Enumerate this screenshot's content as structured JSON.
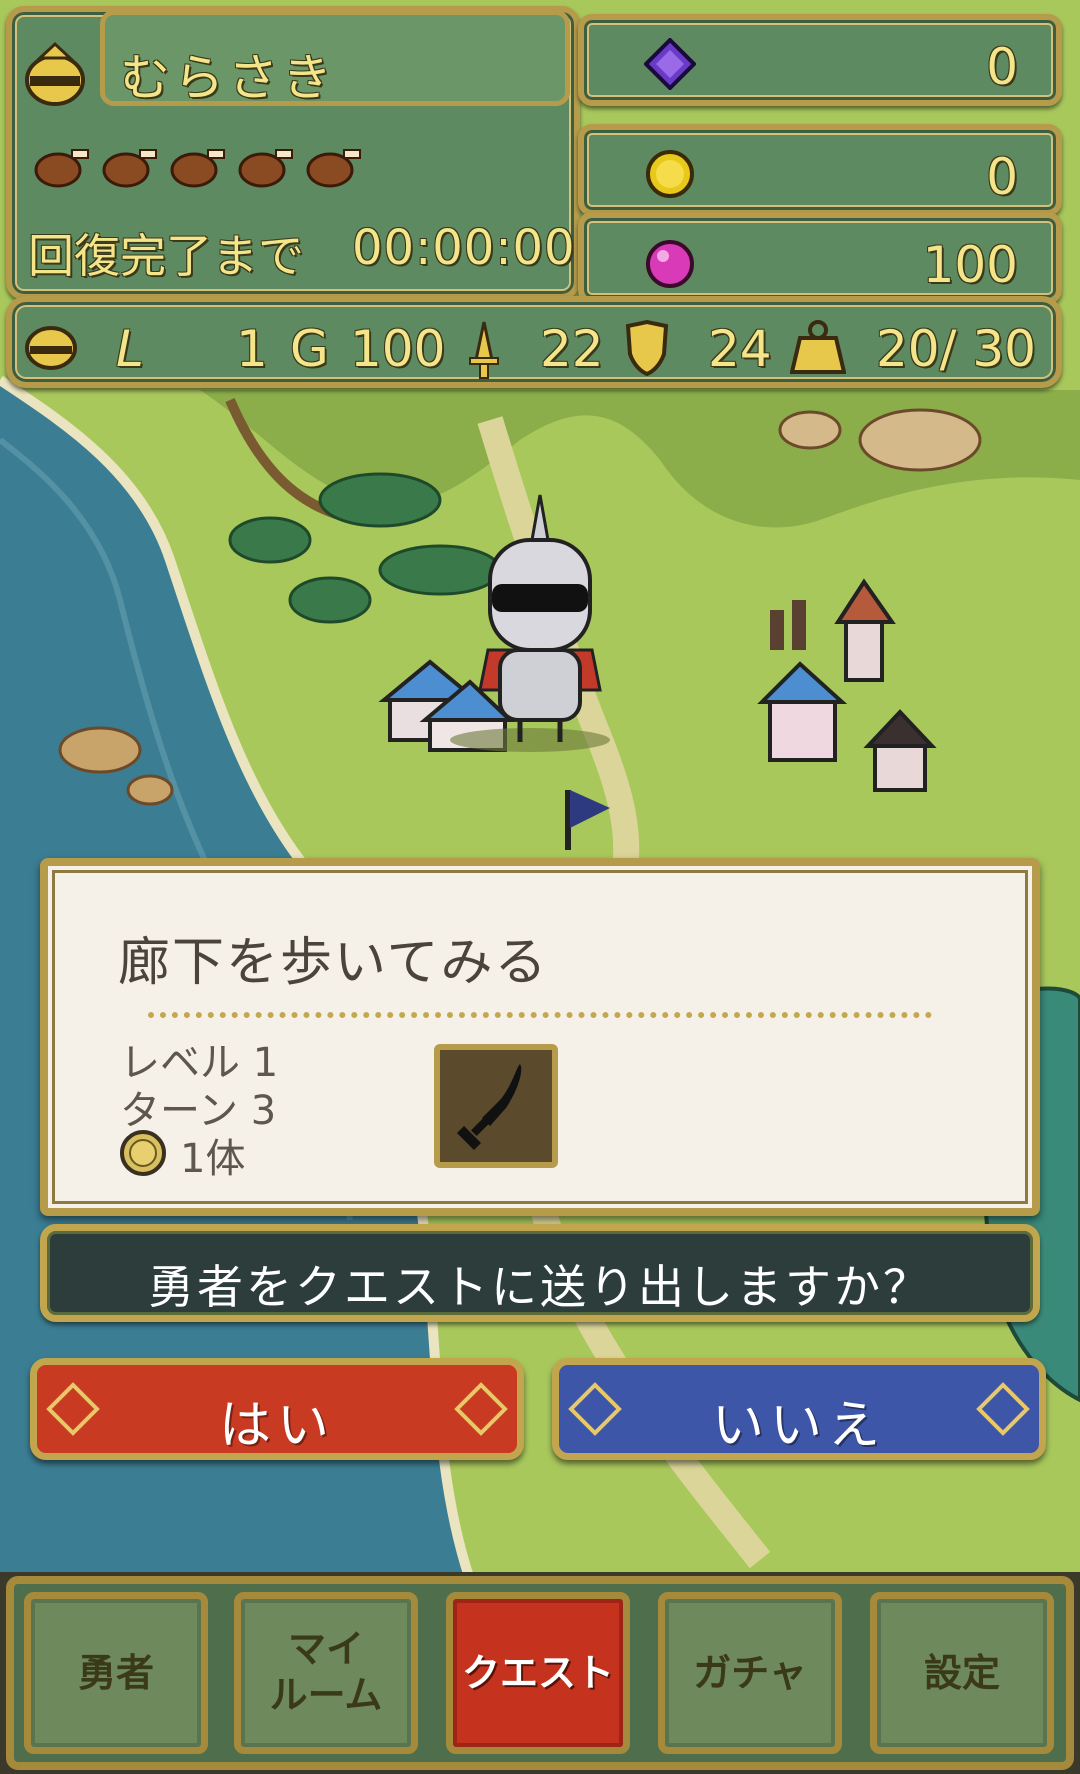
{
  "player": {
    "name": "むらさき"
  },
  "stamina": {
    "meat_count": 5,
    "recovery_label": "回復完了まで",
    "recovery_time": "00:00:00"
  },
  "currencies": {
    "gem": "0",
    "coin": "0",
    "orb": "100"
  },
  "stats": {
    "level_icon": "L",
    "level": "1",
    "gold_icon": "G",
    "gold": "100",
    "attack": "22",
    "defense": "24",
    "weight": "20/ 30"
  },
  "quest": {
    "title": "廊下を歩いてみる",
    "level": "レベル 1",
    "turn": "ターン 3",
    "enemy": "1体",
    "reward_icon": "sword-icon"
  },
  "prompt": {
    "text": "勇者をクエストに送り出しますか？"
  },
  "buttons": {
    "yes": "はい",
    "no": "いいえ"
  },
  "nav": {
    "tabs": [
      {
        "line1": "勇者",
        "line2": ""
      },
      {
        "line1": "マイ",
        "line2": "ルーム"
      },
      {
        "line1": "クエスト",
        "line2": ""
      },
      {
        "line1": "ガチャ",
        "line2": ""
      },
      {
        "line1": "設定",
        "line2": ""
      }
    ],
    "active_tab": 2
  },
  "colors": {
    "accent_gold": "#b59b4a",
    "yes_red": "#c93a22",
    "no_blue": "#3e56a8",
    "panel_green": "#5e8a62"
  }
}
